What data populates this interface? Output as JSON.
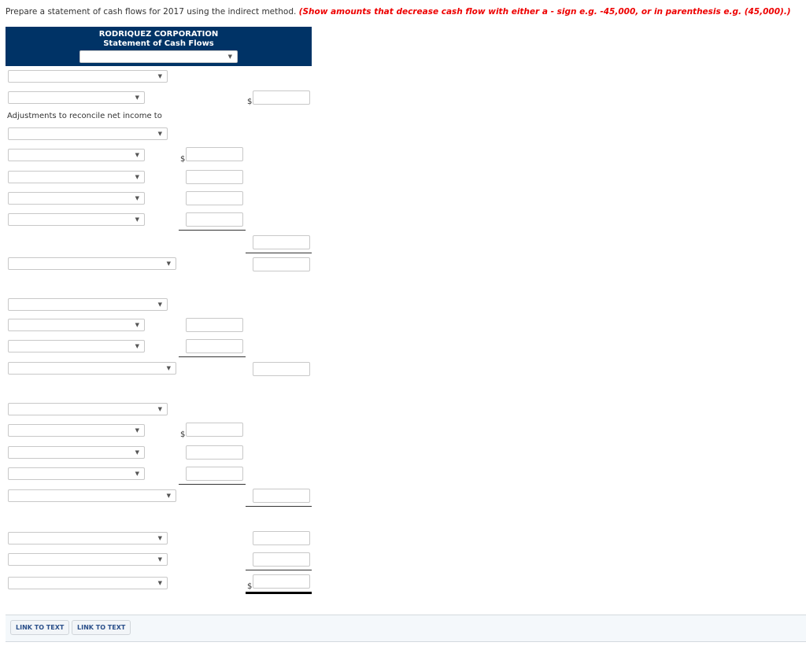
{
  "instructions": {
    "main": "Prepare a statement of cash flows for 2017 using the indirect method. ",
    "note": "(Show amounts that decrease cash flow with either a - sign e.g. -45,000, or in parenthesis e.g. (45,000).)"
  },
  "statement": {
    "company": "RODRIQUEZ CORPORATION",
    "title": "Statement of Cash Flows",
    "period_select": ""
  },
  "labels": {
    "adjustments": "Adjustments to reconcile net income to"
  },
  "currency_symbol": "$",
  "footer": {
    "links": [
      "LINK TO TEXT",
      "LINK TO TEXT"
    ]
  },
  "icons": {
    "dropdown": "▼"
  },
  "colors": {
    "header_bg": "#003366",
    "note_red": "#ee0000",
    "link_blue": "#2a4f8a"
  }
}
